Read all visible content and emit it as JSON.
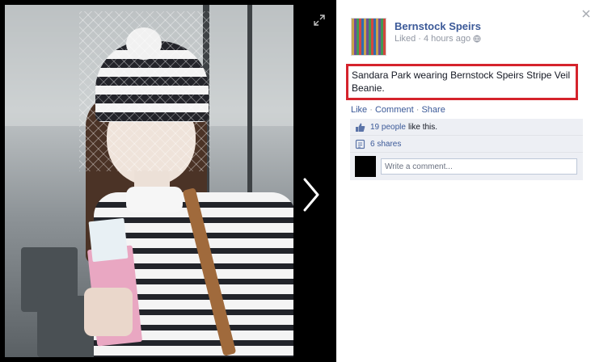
{
  "photo": {
    "description_icon": "photo",
    "expand_icon": "expand-icon",
    "next_icon": "chevron-right-icon"
  },
  "post": {
    "page_name": "Bernstock Speirs",
    "liked_label": "Liked",
    "separator": "·",
    "time": "4 hours ago",
    "privacy_icon": "globe-icon",
    "caption": "Sandara Park wearing Bernstock Speirs Stripe Veil Beanie."
  },
  "actions": {
    "like": "Like",
    "comment": "Comment",
    "share": "Share",
    "separator": "·"
  },
  "ufi": {
    "likes_link": "19 people",
    "likes_suffix": "like this.",
    "shares_link": "6 shares",
    "comment_placeholder": "Write a comment..."
  },
  "colors": {
    "brand_link": "#3b5998",
    "highlight_box": "#d5232c",
    "ufi_background": "#edeff4"
  }
}
